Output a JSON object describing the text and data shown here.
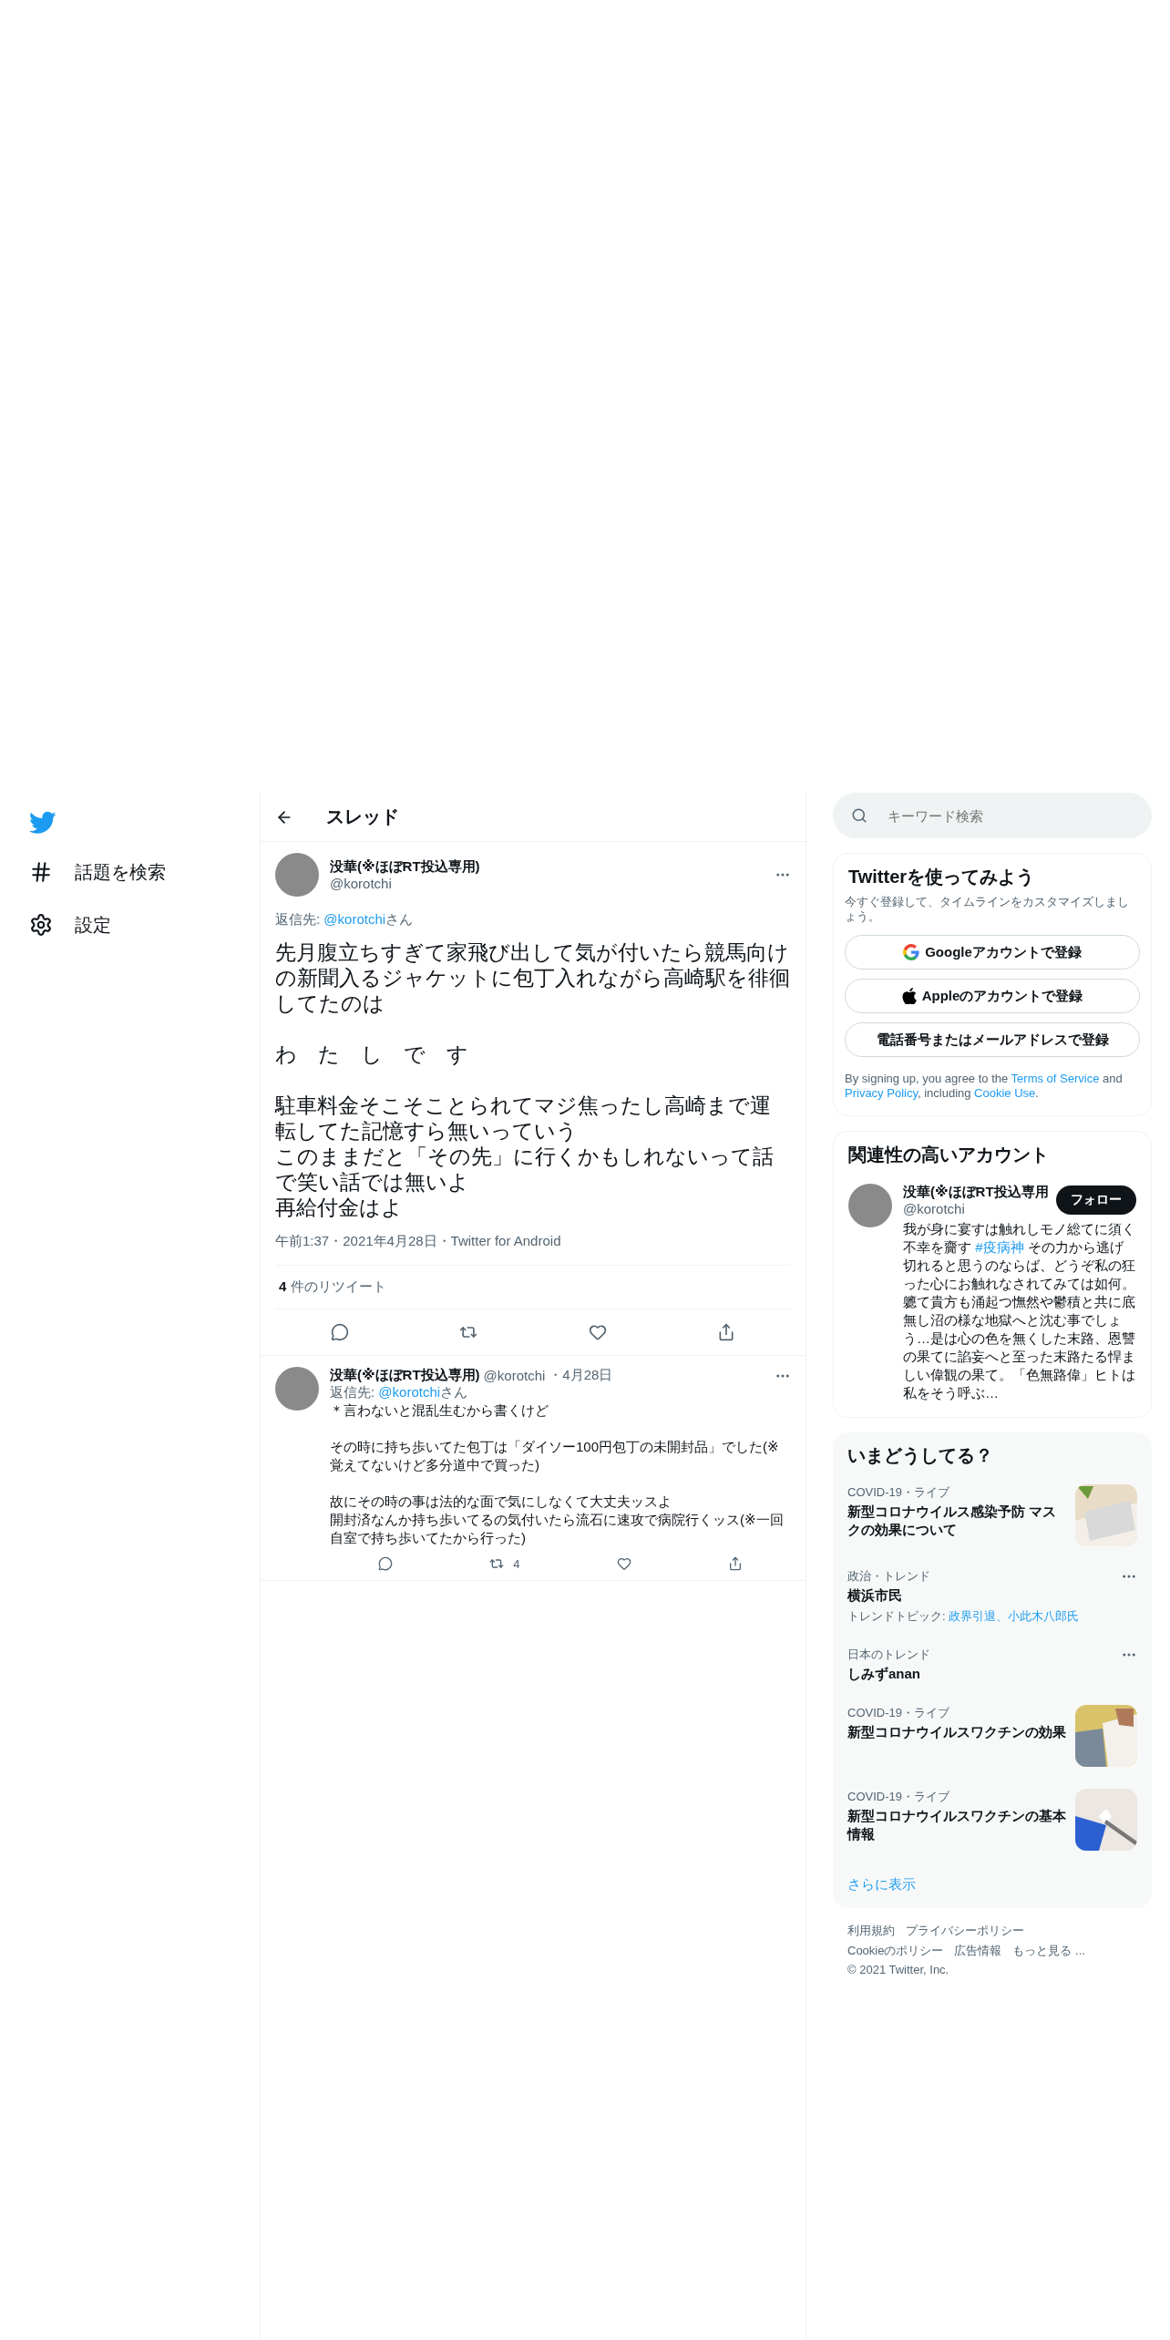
{
  "nav": [
    {
      "kind": "hashtag",
      "label": "話題を検索"
    },
    {
      "kind": "settings",
      "label": "設定"
    }
  ],
  "header": {
    "title": "スレッド"
  },
  "main_tweet": {
    "name": "没華(※ほぼRT投込専用)",
    "handle": "@korotchi",
    "reply_prefix": "返信先: ",
    "reply_mention": "@korotchi",
    "reply_suffix": "さん",
    "text": [
      [
        "先月腹立ちすぎて家飛び出して気が付いたら競馬向けの新聞入るジャケットに包丁入れながら高崎駅を徘徊してたのは"
      ],
      [
        "わ　た　し　で　す"
      ],
      [
        "駐車料金そこそことられてマジ焦ったし高崎まで運転してた記憶すら無いっていう",
        "このままだと「その先」に行くかもしれないって話で笑い話では無いよ",
        "再給付金はよ"
      ]
    ],
    "timestamp": "午前1:37・2021年4月28日・Twitter for Android",
    "retweets": "**4** 件のリツイート"
  },
  "reply_tweet": {
    "name": "没華(※ほぼRT投込専用)",
    "handle": "@korotchi",
    "date": "・4月28日",
    "reply_prefix": "返信先: ",
    "reply_mention": "@korotchi",
    "reply_suffix": "さん",
    "text": [
      [
        "＊言わないと混乱生むから書くけど"
      ],
      [
        "その時に持ち歩いてた包丁は「ダイソー100円包丁の未開封品」でした(※覚えてないけど多分道中で買った)"
      ],
      [
        "故にその時の事は法的な面で気にしなくて大丈夫ッスよ",
        "開封済なんか持ち歩いてるの気付いたら流石に速攻で病院行くッス(※一回自室で持ち歩いてたから行った)"
      ]
    ],
    "retweet_count": "4"
  },
  "search": {
    "placeholder": "キーワード検索"
  },
  "signup": {
    "title": "Twitterを使ってみよう",
    "subtitle": "今すぐ登録して、タイムラインをカスタマイズしましょう。",
    "buttons": [
      {
        "kind": "google",
        "label": "Googleアカウントで登録"
      },
      {
        "kind": "apple",
        "label": "Appleのアカウントで登録"
      },
      {
        "kind": "plain",
        "label": "電話番号またはメールアドレスで登録"
      }
    ],
    "terms": [
      {
        "kind": "text",
        "text": "By signing up, you agree to the "
      },
      {
        "kind": "link",
        "text": "Terms of Service"
      },
      {
        "kind": "text",
        "text": " and "
      },
      {
        "kind": "link",
        "text": "Privacy Policy"
      },
      {
        "kind": "text",
        "text": ", including "
      },
      {
        "kind": "link",
        "text": "Cookie Use"
      },
      {
        "kind": "text",
        "text": "."
      }
    ]
  },
  "related": {
    "title": "関連性の高いアカウント",
    "name": "没華(※ほぼRT投込専用",
    "handle": "@korotchi",
    "follow": "フォロー",
    "bio": [
      {
        "kind": "text",
        "text": "我が身に宴すは触れしモノ総てに須く不幸を齎す "
      },
      {
        "kind": "link",
        "text": "#疫病神"
      },
      {
        "kind": "text",
        "text": " その力から逃げ切れると思うのならば、どうぞ私の狂った心にお触れなされてみては如何。軈て貴方も涌起つ憮然や鬱積と共に底無し沼の様な地獄へと沈む事でしょう…是は心の色を無くした末路、恩讐の果てに諂妄へと至った末路たる悍ましい偉観の果て。「色無路偉」ヒトは私をそう呼ぶ…"
      }
    ]
  },
  "trends": {
    "title": "いまどうしてる？",
    "more": "さらに表示",
    "items": [
      {
        "kind": "picture",
        "context": "COVID-19・ライブ",
        "title": "新型コロナウイルス感染予防 マスクの効果について"
      },
      {
        "kind": "menu",
        "context": "政治・トレンド",
        "title": "横浜市民",
        "topics_label": "トレンドトピック: ",
        "topics": "政界引退、小此木八郎氏"
      },
      {
        "kind": "menu",
        "context": "日本のトレンド",
        "title": "しみずanan"
      },
      {
        "kind": "picture",
        "context": "COVID-19・ライブ",
        "title": "新型コロナウイルスワクチンの効果"
      },
      {
        "kind": "picture",
        "context": "COVID-19・ライブ",
        "title": "新型コロナウイルスワクチンの基本情報"
      }
    ]
  },
  "footer": {
    "rows": [
      [
        "利用規約",
        "プライバシーポリシー"
      ],
      [
        "Cookieのポリシー",
        "広告情報",
        "もっと見る ..."
      ]
    ],
    "copyright": "© 2021 Twitter, Inc."
  }
}
